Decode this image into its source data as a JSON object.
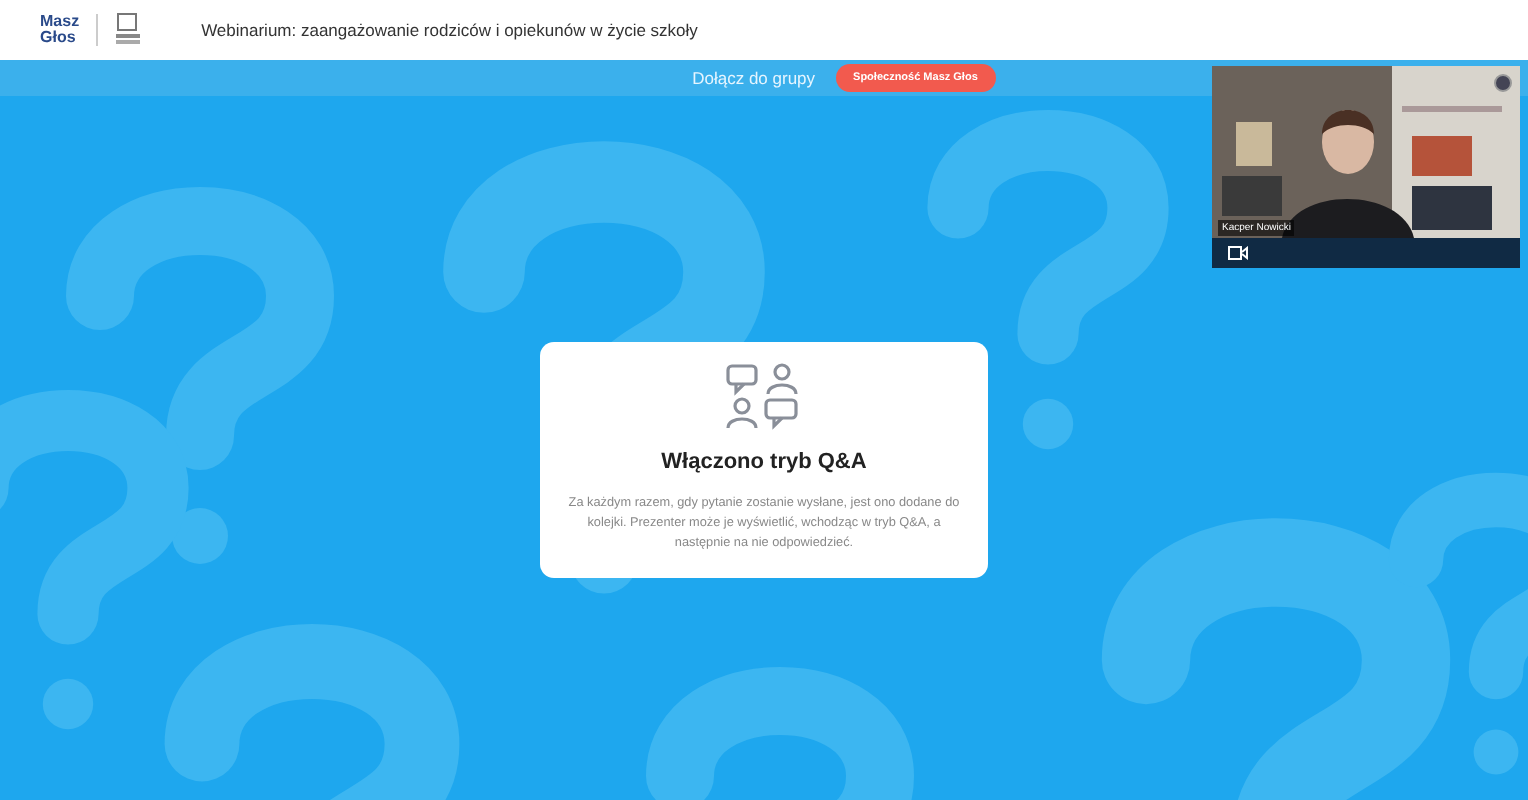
{
  "header": {
    "logo": [
      "Masz",
      "Głos"
    ],
    "title": "Webinarium: zaangażowanie rodziców i opiekunów w życie szkoły"
  },
  "banner": {
    "text": "Dołącz do grupy",
    "button": "Społeczność Masz Głos"
  },
  "video": {
    "kind": "picture",
    "name": "Kacper Nowicki"
  },
  "card": {
    "title": "Włączono tryb Q&A",
    "text": "Za każdym razem, gdy pytanie zostanie wysłane, jest ono dodane do kolejki. Prezenter może je wyświetlić, wchodząc w tryb Q&A, a następnie na nie odpowiedzieć."
  }
}
